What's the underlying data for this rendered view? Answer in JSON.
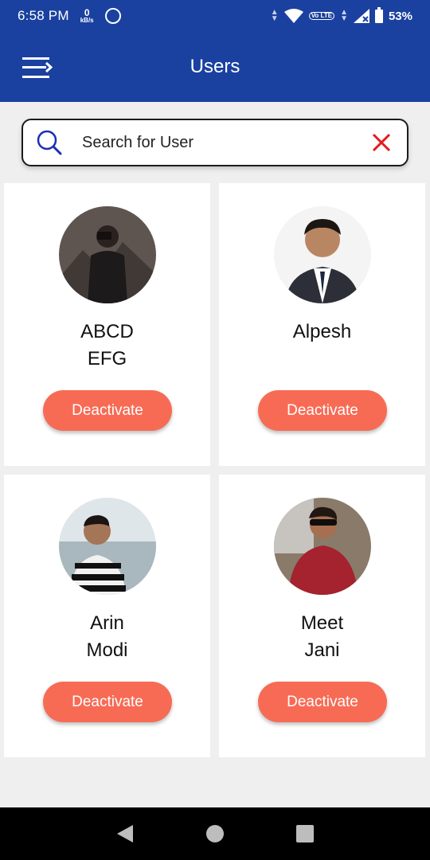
{
  "status_bar": {
    "time": "6:58 PM",
    "net_speed_value": "0",
    "net_speed_unit": "kB/s",
    "volte": "Vo LTE",
    "battery_percent": "53%"
  },
  "app_bar": {
    "title": "Users",
    "menu_icon": "menu-icon"
  },
  "search": {
    "placeholder": "Search for User",
    "value": "",
    "search_icon": "search-icon",
    "clear_icon": "close-icon",
    "clear_color": "#e31b1b"
  },
  "users": [
    {
      "name_line1": "ABCD",
      "name_line2": "EFG",
      "action_label": "Deactivate"
    },
    {
      "name_line1": "Alpesh",
      "name_line2": "",
      "action_label": "Deactivate"
    },
    {
      "name_line1": "Arin",
      "name_line2": "Modi",
      "action_label": "Deactivate"
    },
    {
      "name_line1": "Meet",
      "name_line2": "Jani",
      "action_label": "Deactivate"
    }
  ],
  "colors": {
    "primary": "#1a41a0",
    "button": "#f76b55",
    "background": "#efefef"
  },
  "nav_bar": {
    "back_icon": "back-triangle-icon",
    "home_icon": "home-circle-icon",
    "recents_icon": "recents-square-icon"
  }
}
